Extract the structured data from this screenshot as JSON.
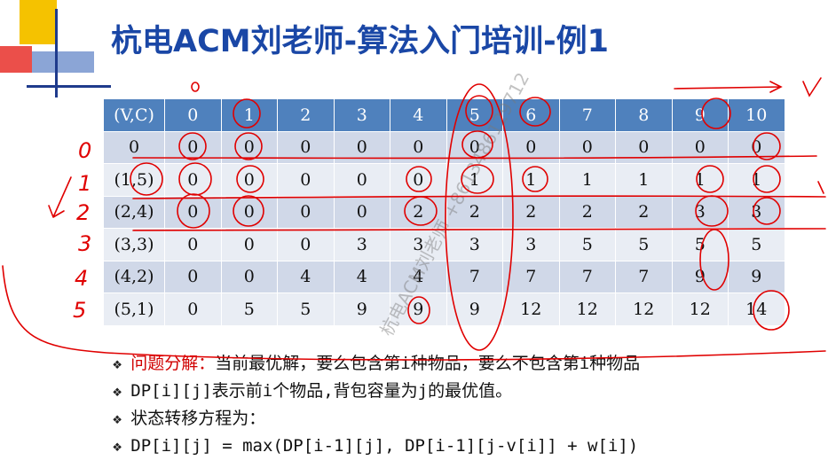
{
  "slide": {
    "title": "杭电ACM刘老师-算法入门培训-例1",
    "watermark": "杭电ACM刘老师 +8613486129712"
  },
  "table": {
    "header": [
      "(V,C)",
      "0",
      "1",
      "2",
      "3",
      "4",
      "5",
      "6",
      "7",
      "8",
      "9",
      "10"
    ],
    "rows": [
      [
        "0",
        "0",
        "0",
        "0",
        "0",
        "0",
        "0",
        "0",
        "0",
        "0",
        "0",
        "0"
      ],
      [
        "(1,5)",
        "0",
        "0",
        "0",
        "0",
        "0",
        "1",
        "1",
        "1",
        "1",
        "1",
        "1"
      ],
      [
        "(2,4)",
        "0",
        "0",
        "0",
        "0",
        "2",
        "2",
        "2",
        "2",
        "2",
        "3",
        "3"
      ],
      [
        "(3,3)",
        "0",
        "0",
        "0",
        "3",
        "3",
        "3",
        "3",
        "5",
        "5",
        "5",
        "5"
      ],
      [
        "(4,2)",
        "0",
        "0",
        "4",
        "4",
        "4",
        "7",
        "7",
        "7",
        "7",
        "9",
        "9"
      ],
      [
        "(5,1)",
        "0",
        "5",
        "5",
        "9",
        "9",
        "9",
        "12",
        "12",
        "12",
        "12",
        "14"
      ]
    ]
  },
  "bullets": [
    {
      "label": "问题分解：",
      "text": "当前最优解，要么包含第i种物品，要么不包含第i种物品"
    },
    {
      "label": "",
      "text": "DP[i][j]表示前i个物品,背包容量为j的最优值。"
    },
    {
      "label": "",
      "text": "状态转移方程为："
    },
    {
      "label": "",
      "text": "DP[i][j] = max(DP[i-1][j], DP[i-1][j-v[i]] + w[i])"
    }
  ],
  "annotations": {
    "handwritten_numbers": [
      "0",
      "0",
      "1",
      "2",
      "3",
      "4",
      "5"
    ],
    "ink_color": "#e00000"
  },
  "colors": {
    "title": "#1a47a6",
    "header_bg": "#4f81bd",
    "row_odd": "#d0d8e8",
    "row_even": "#e9edf4",
    "logo_yellow": "#f5c200",
    "logo_red": "#e8302a",
    "logo_blue": "#1f3b8c"
  }
}
